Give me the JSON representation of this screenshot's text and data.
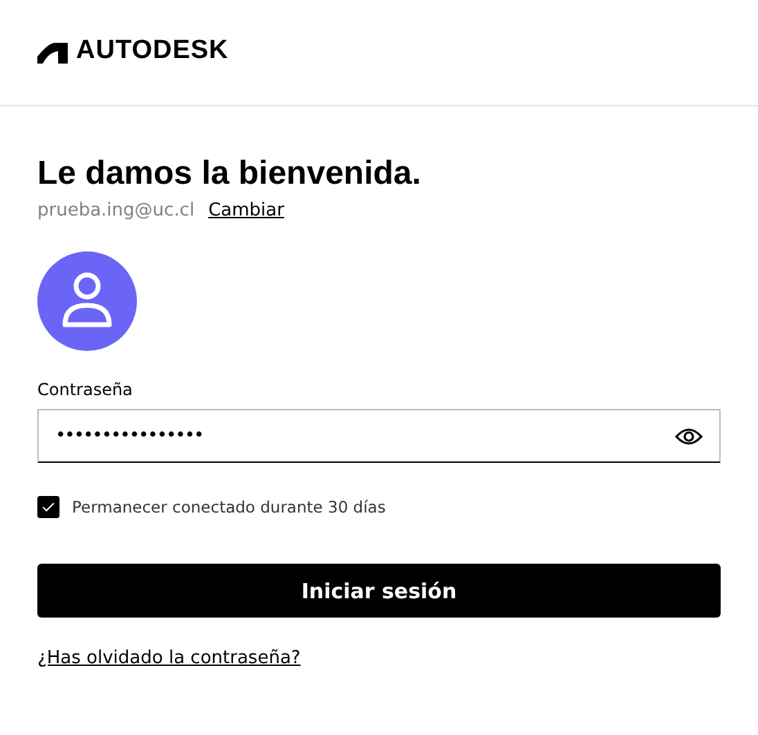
{
  "header": {
    "logo_text": "AUTODESK"
  },
  "title": "Le damos la bienvenida.",
  "account": {
    "email": "prueba.ing@uc.cl",
    "change_link": "Cambiar"
  },
  "password": {
    "label": "Contraseña",
    "value": "••••••••••••••••"
  },
  "remember": {
    "label": "Permanecer conectado durante 30 días",
    "checked": true
  },
  "submit": "Iniciar sesión",
  "forgot_link": "¿Has olvidado la contraseña?"
}
